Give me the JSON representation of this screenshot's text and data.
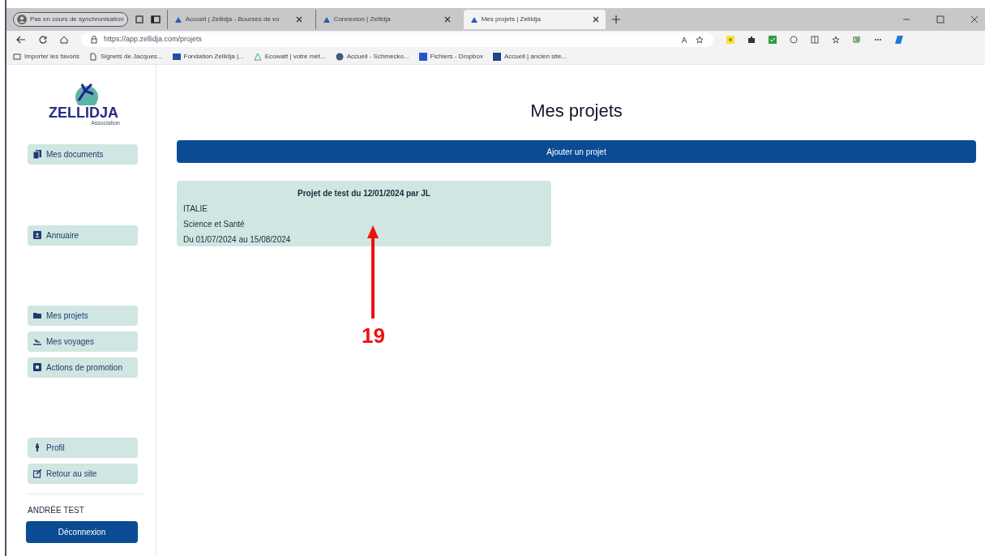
{
  "browser": {
    "profile": "Pas en cours de synchronisation",
    "tabs": [
      {
        "title": "Accueil | Zellidja - Bourses de vo",
        "selected": false
      },
      {
        "title": "Connexion | Zellidja",
        "selected": false
      },
      {
        "title": "Mes projets | Zellidja",
        "selected": true
      }
    ],
    "url": "https://app.zellidja.com/projets",
    "bookmarks": [
      "Importer les favoris",
      "Signets de Jacques...",
      "Fondation Zellidja |...",
      "Ecowatt | votre mét...",
      "Accueil - Schmecko...",
      "Fichiers - Dropbox",
      "Accueil | ancien site..."
    ]
  },
  "sidebar": {
    "logo": {
      "wordmark": "ZELLIDJA",
      "subtitle": "Association"
    },
    "groups": [
      {
        "items": [
          {
            "label": "Mes documents"
          }
        ]
      },
      {
        "items": [
          {
            "label": "Annuaire"
          }
        ]
      },
      {
        "items": [
          {
            "label": "Mes projets"
          },
          {
            "label": "Mes voyages"
          },
          {
            "label": "Actions de promotion"
          }
        ]
      },
      {
        "items": [
          {
            "label": "Profil"
          },
          {
            "label": "Retour au site"
          }
        ]
      }
    ],
    "user": "ANDRÉE TEST",
    "logout": "Déconnexion"
  },
  "main": {
    "title": "Mes projets",
    "add_button": "Ajouter un projet",
    "projects": [
      {
        "title": "Projet de test du 12/01/2024 par JL",
        "country": "ITALIE",
        "theme": "Science et Santé",
        "dates": "Du 01/07/2024 au 15/08/2024"
      }
    ]
  },
  "annotation": {
    "label": "19"
  }
}
